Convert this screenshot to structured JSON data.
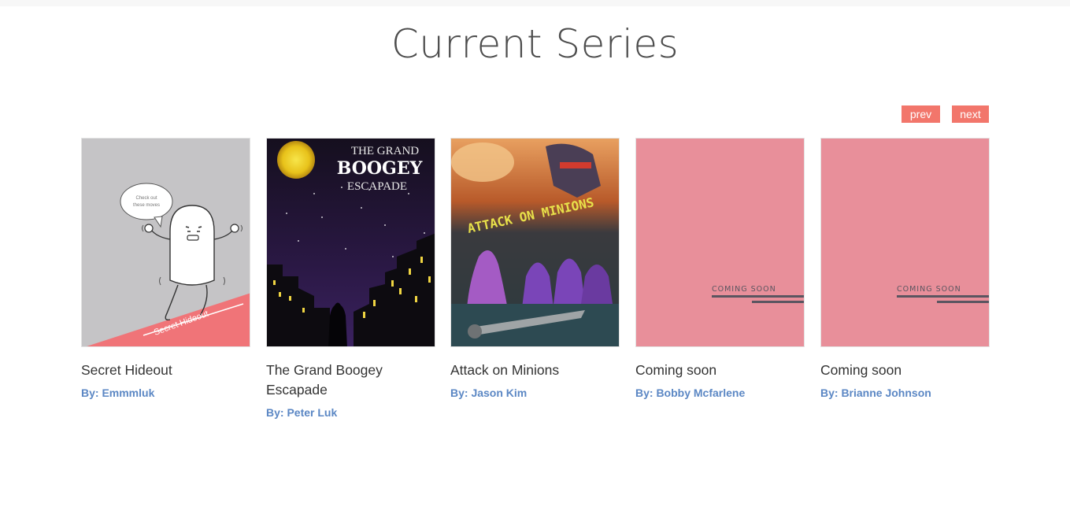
{
  "section": {
    "title": "Current Series"
  },
  "pager": {
    "prev_label": "prev",
    "next_label": "next"
  },
  "series": [
    {
      "title": "Secret Hideout",
      "author": "By: Emmmluk",
      "cover": "secret-hideout-cover",
      "cover_text": "Secret Hideout",
      "bubble_line1": "Check out",
      "bubble_line2": "these moves"
    },
    {
      "title": "The Grand Boogey Escapade",
      "author": "By: Peter Luk",
      "cover": "grand-boogey-cover",
      "cover_line1": "THE GRAND",
      "cover_line2": "BOOGEY",
      "cover_line3": "ESCAPADE"
    },
    {
      "title": "Attack on Minions",
      "author": "By: Jason Kim",
      "cover": "attack-on-minions-cover",
      "cover_text": "ATTACK ON MINIONS"
    },
    {
      "title": "Coming soon",
      "author": "By: Bobby Mcfarlene",
      "cover": "coming-soon-cover",
      "cover_text": "COMING SOON"
    },
    {
      "title": "Coming soon",
      "author": "By: Brianne Johnson",
      "cover": "coming-soon-cover",
      "cover_text": "COMING SOON"
    }
  ],
  "colors": {
    "accent": "#f2766b",
    "author_link": "#5b87c4",
    "coming_soon_bg": "#e88f9a"
  }
}
